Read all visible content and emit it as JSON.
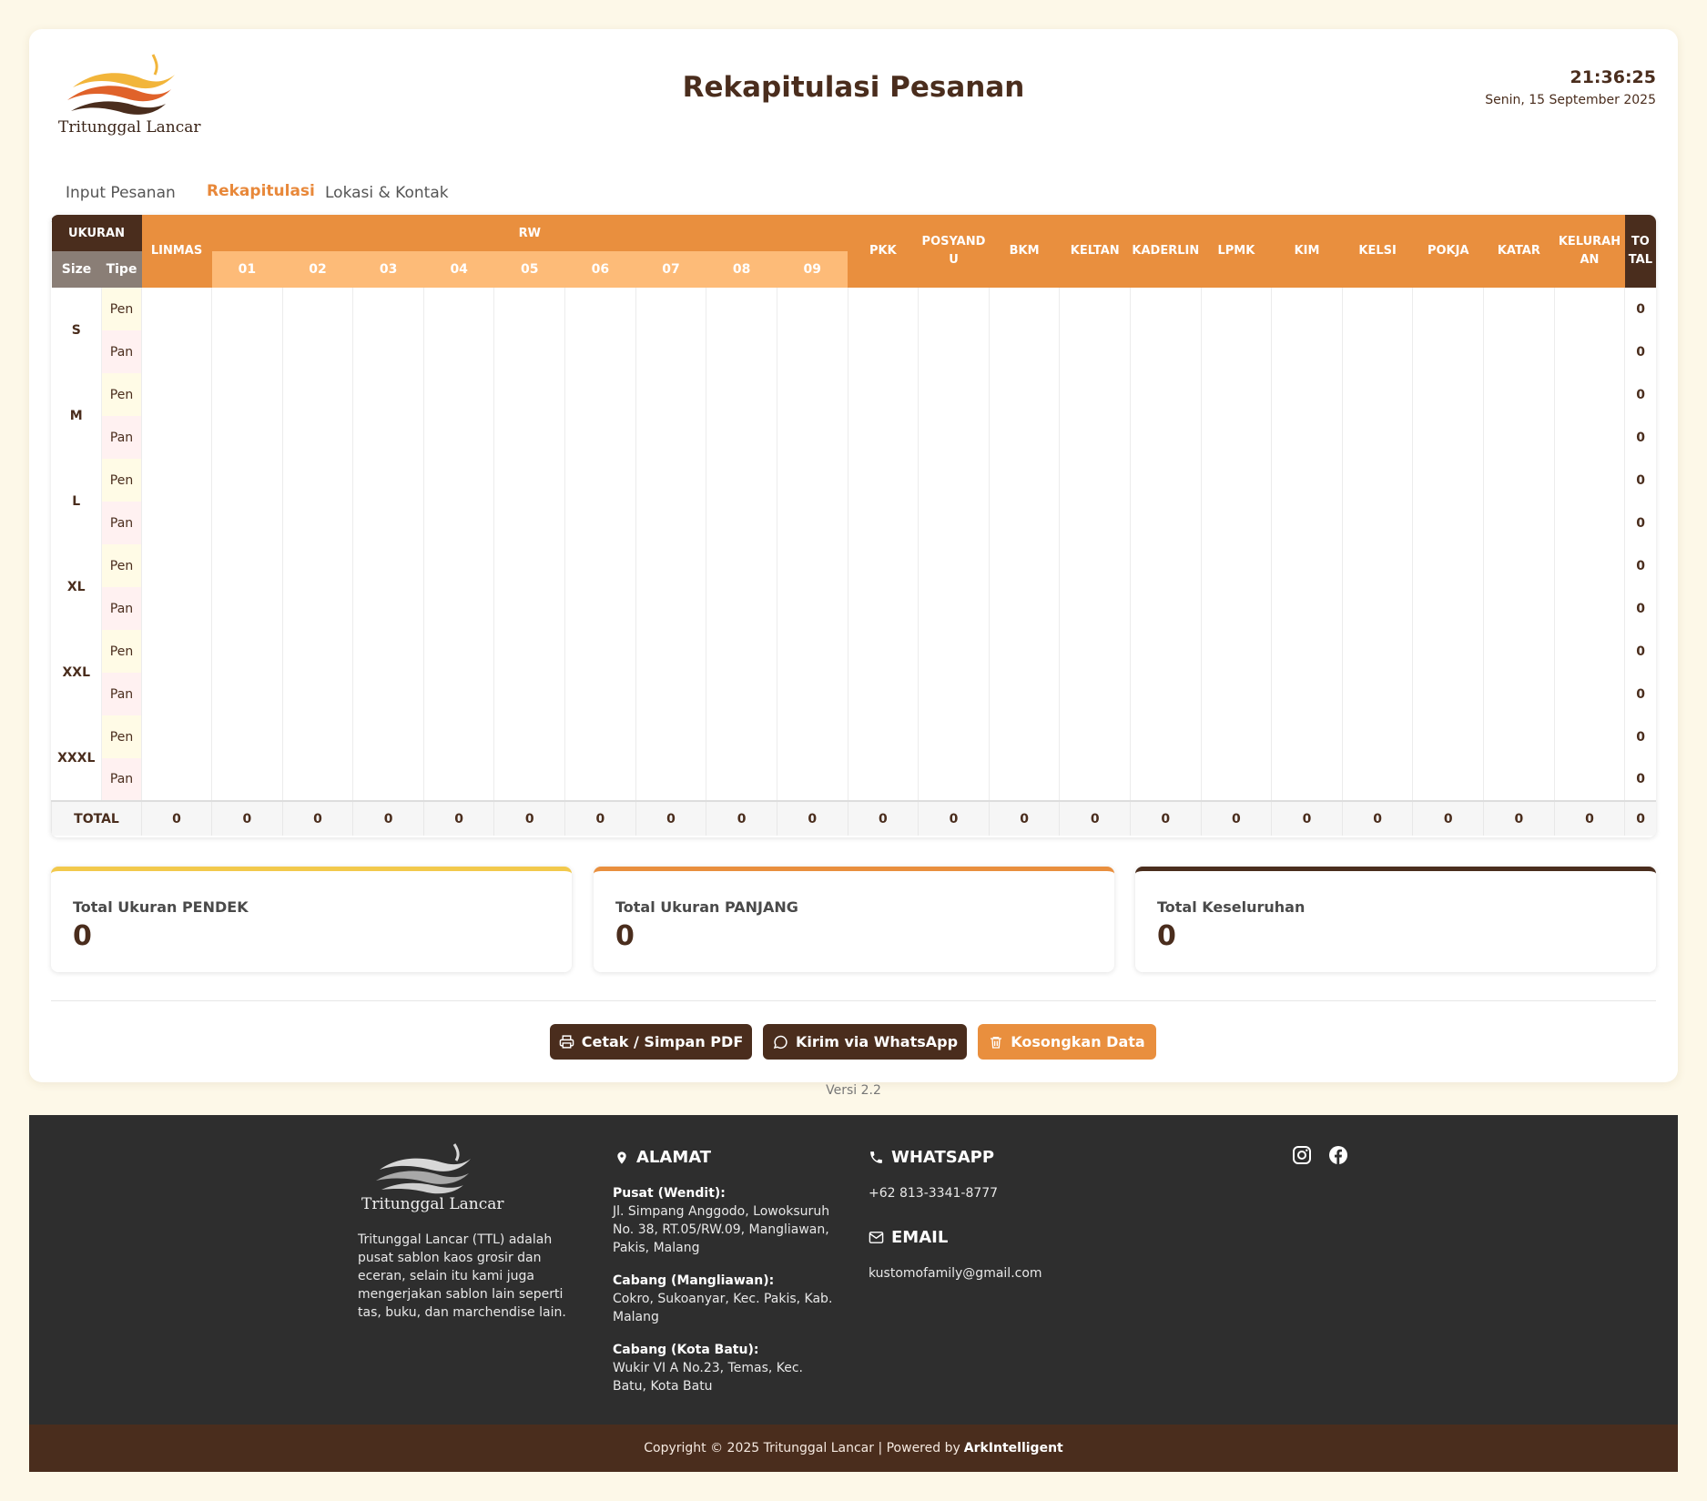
{
  "brand": {
    "name": "Tritunggal Lancar"
  },
  "header": {
    "title": "Rekapitulasi Pesanan",
    "time": "21:36:25",
    "date": "Senin, 15 September 2025"
  },
  "tabs": [
    {
      "label": "Input Pesanan",
      "active": false
    },
    {
      "label": "Rekapitulasi",
      "active": true
    },
    {
      "label": "Lokasi & Kontak",
      "active": false
    }
  ],
  "table": {
    "ukuran_header": "UKURAN",
    "size_header": "Size",
    "tipe_header": "Tipe",
    "linmas_header": "LINMAS",
    "rw_header": "RW",
    "rw_numbers": [
      "01",
      "02",
      "03",
      "04",
      "05",
      "06",
      "07",
      "08",
      "09"
    ],
    "other_headers": [
      "PKK",
      "POSYANDU",
      "BKM",
      "KELTAN",
      "KADERLIN",
      "LPMK",
      "KIM",
      "KELSI",
      "POKJA",
      "KATAR",
      "KELURAHAN"
    ],
    "other_headers_display": [
      "PKK",
      "POSYAND U",
      "BKM",
      "KELTAN",
      "KADERLIN",
      "LPMK",
      "KIM",
      "KELSI",
      "POKJA",
      "KATAR",
      "KELURAH AN"
    ],
    "total_header": "TO TAL",
    "sizes": [
      "S",
      "M",
      "L",
      "XL",
      "XXL",
      "XXXL"
    ],
    "types": [
      "Pen",
      "Pan"
    ],
    "row_totals": [
      "0",
      "0",
      "0",
      "0",
      "0",
      "0",
      "0",
      "0",
      "0",
      "0",
      "0",
      "0"
    ],
    "footer_label": "TOTAL",
    "footer_values": [
      "0",
      "0",
      "0",
      "0",
      "0",
      "0",
      "0",
      "0",
      "0",
      "0",
      "0",
      "0",
      "0",
      "0",
      "0",
      "0",
      "0",
      "0",
      "0",
      "0",
      "0",
      "0"
    ]
  },
  "summary": [
    {
      "label": "Total Ukuran PENDEK",
      "value": "0",
      "accent": "#f2c94c"
    },
    {
      "label": "Total Ukuran PANJANG",
      "value": "0",
      "accent": "#e98f3e"
    },
    {
      "label": "Total Keseluruhan",
      "value": "0",
      "accent": "#4a2d1d"
    }
  ],
  "actions": {
    "print_label": "Cetak / Simpan PDF",
    "whatsapp_label": "Kirim via WhatsApp",
    "clear_label": "Kosongkan Data"
  },
  "version": "Versi 2.2",
  "footer": {
    "about": "Tritunggal Lancar (TTL) adalah pusat sablon kaos grosir dan eceran, selain itu kami juga mengerjakan sablon lain seperti tas, buku, dan marchendise lain.",
    "alamat_title": "ALAMAT",
    "pusat_title": "Pusat (Wendit):",
    "pusat_text": "Jl. Simpang Anggodo, Lowoksuruh No. 38, RT.05/RW.09, Mangliawan, Pakis, Malang",
    "cabang1_title": "Cabang (Mangliawan):",
    "cabang1_text": "Cokro, Sukoanyar, Kec. Pakis, Kab. Malang",
    "cabang2_title": "Cabang (Kota Batu):",
    "cabang2_text": "Wukir VI A No.23, Temas, Kec. Batu, Kota Batu",
    "whatsapp_title": "WHATSAPP",
    "whatsapp_number": "+62 813-3341-8777",
    "email_title": "EMAIL",
    "email": "kustomofamily@gmail.com"
  },
  "copyright": {
    "text": "Copyright © 2025 Tritunggal Lancar | Powered by",
    "powered": "ArkIntelligent"
  },
  "colors": {
    "brown": "#4a2d1d",
    "orange": "#e98f3e",
    "light_orange": "#fdbb78",
    "yellow": "#f2c94c",
    "bg": "#fdf8e8"
  }
}
